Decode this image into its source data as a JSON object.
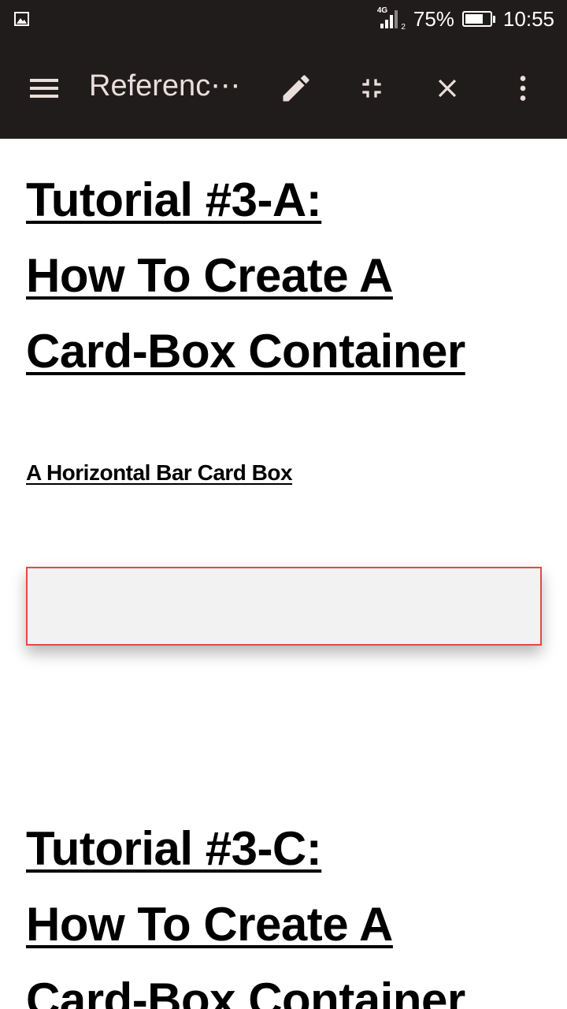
{
  "status_bar": {
    "network": "4G",
    "sim": "2",
    "battery_percent": "75%",
    "battery_level": 0.75,
    "time": "10:55"
  },
  "app_bar": {
    "title": "Referenc⋯",
    "icons": [
      "menu-icon",
      "edit-pencil-icon",
      "exit-fullscreen-icon",
      "close-icon",
      "more-vert-icon"
    ],
    "color": "#201c1b",
    "icon_color": "#e9dedb"
  },
  "content": {
    "tutorial_a": {
      "line1": "Tutorial #3-A:",
      "line2": "How To Create A",
      "line3": "Card-Box Container"
    },
    "subheading": "A Horizontal Bar Card Box",
    "card_box": {
      "background": "#f2f2f2",
      "border_color": "#e34a40"
    },
    "tutorial_c": {
      "line1": "Tutorial #3-C:",
      "line2": "How To Create A",
      "line3": "Card-Box Container"
    }
  }
}
